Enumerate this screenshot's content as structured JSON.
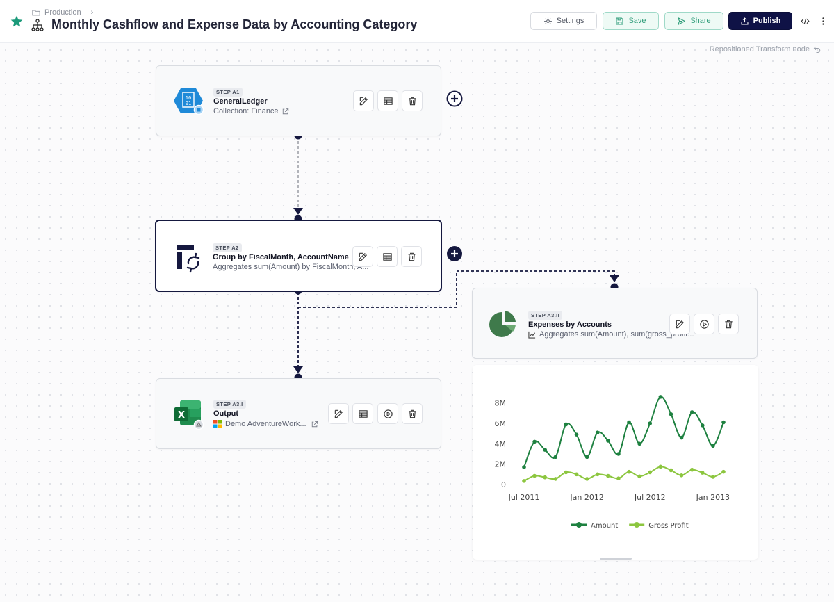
{
  "header": {
    "breadcrumb": "Production",
    "title": "Monthly Cashflow and Expense Data by Accounting Category",
    "buttons": {
      "settings": "Settings",
      "save": "Save",
      "share": "Share",
      "publish": "Publish"
    }
  },
  "status_message": "Repositioned Transform node",
  "nodes": {
    "a1": {
      "step": "STEP A1",
      "title": "GeneralLedger",
      "subtitle": "Collection: Finance"
    },
    "a2": {
      "step": "STEP A2",
      "title": "Group by FiscalMonth, AccountName",
      "subtitle": "Aggregates sum(Amount) by FiscalMonth, A..."
    },
    "a31": {
      "step": "STEP A3.I",
      "title": "Output",
      "subtitle": "Demo AdventureWork..."
    },
    "a32": {
      "step": "STEP A3.II",
      "title": "Expenses by Accounts",
      "subtitle": "Aggregates sum(Amount), sum(gross_profit..."
    }
  },
  "colors": {
    "accent": "#0f1246",
    "save_green": "#2e9c79",
    "amount": "#1e8140",
    "gross_profit": "#8cc63f"
  },
  "chart_data": {
    "type": "line",
    "x": [
      "2011-07",
      "2011-08",
      "2011-09",
      "2011-10",
      "2011-11",
      "2011-12",
      "2012-01",
      "2012-02",
      "2012-03",
      "2012-04",
      "2012-05",
      "2012-06",
      "2012-07",
      "2012-08",
      "2012-09",
      "2012-10",
      "2012-11",
      "2012-12",
      "2013-01",
      "2013-02"
    ],
    "series": [
      {
        "name": "Amount",
        "color": "#1e8140",
        "values": [
          1.7,
          4.2,
          3.4,
          2.7,
          5.9,
          4.9,
          2.7,
          5.1,
          4.3,
          3.0,
          6.1,
          4.0,
          6.0,
          8.6,
          6.9,
          4.6,
          7.1,
          5.8,
          3.8,
          6.1
        ]
      },
      {
        "name": "Gross Profit",
        "color": "#8cc63f",
        "values": [
          0.35,
          0.85,
          0.7,
          0.55,
          1.2,
          1.0,
          0.55,
          1.0,
          0.85,
          0.6,
          1.25,
          0.8,
          1.2,
          1.75,
          1.4,
          0.9,
          1.45,
          1.15,
          0.75,
          1.25
        ]
      }
    ],
    "xticks": [
      {
        "x": "2011-07",
        "label": "Jul 2011"
      },
      {
        "x": "2012-01",
        "label": "Jan 2012"
      },
      {
        "x": "2012-07",
        "label": "Jul 2012"
      },
      {
        "x": "2013-01",
        "label": "Jan 2013"
      }
    ],
    "yticks": [
      {
        "value": 0,
        "label": "0"
      },
      {
        "value": 2,
        "label": "2M"
      },
      {
        "value": 4,
        "label": "4M"
      },
      {
        "value": 6,
        "label": "6M"
      },
      {
        "value": 8,
        "label": "8M"
      }
    ],
    "ylim": [
      0,
      9
    ],
    "grid": false,
    "legend": "bottom"
  }
}
